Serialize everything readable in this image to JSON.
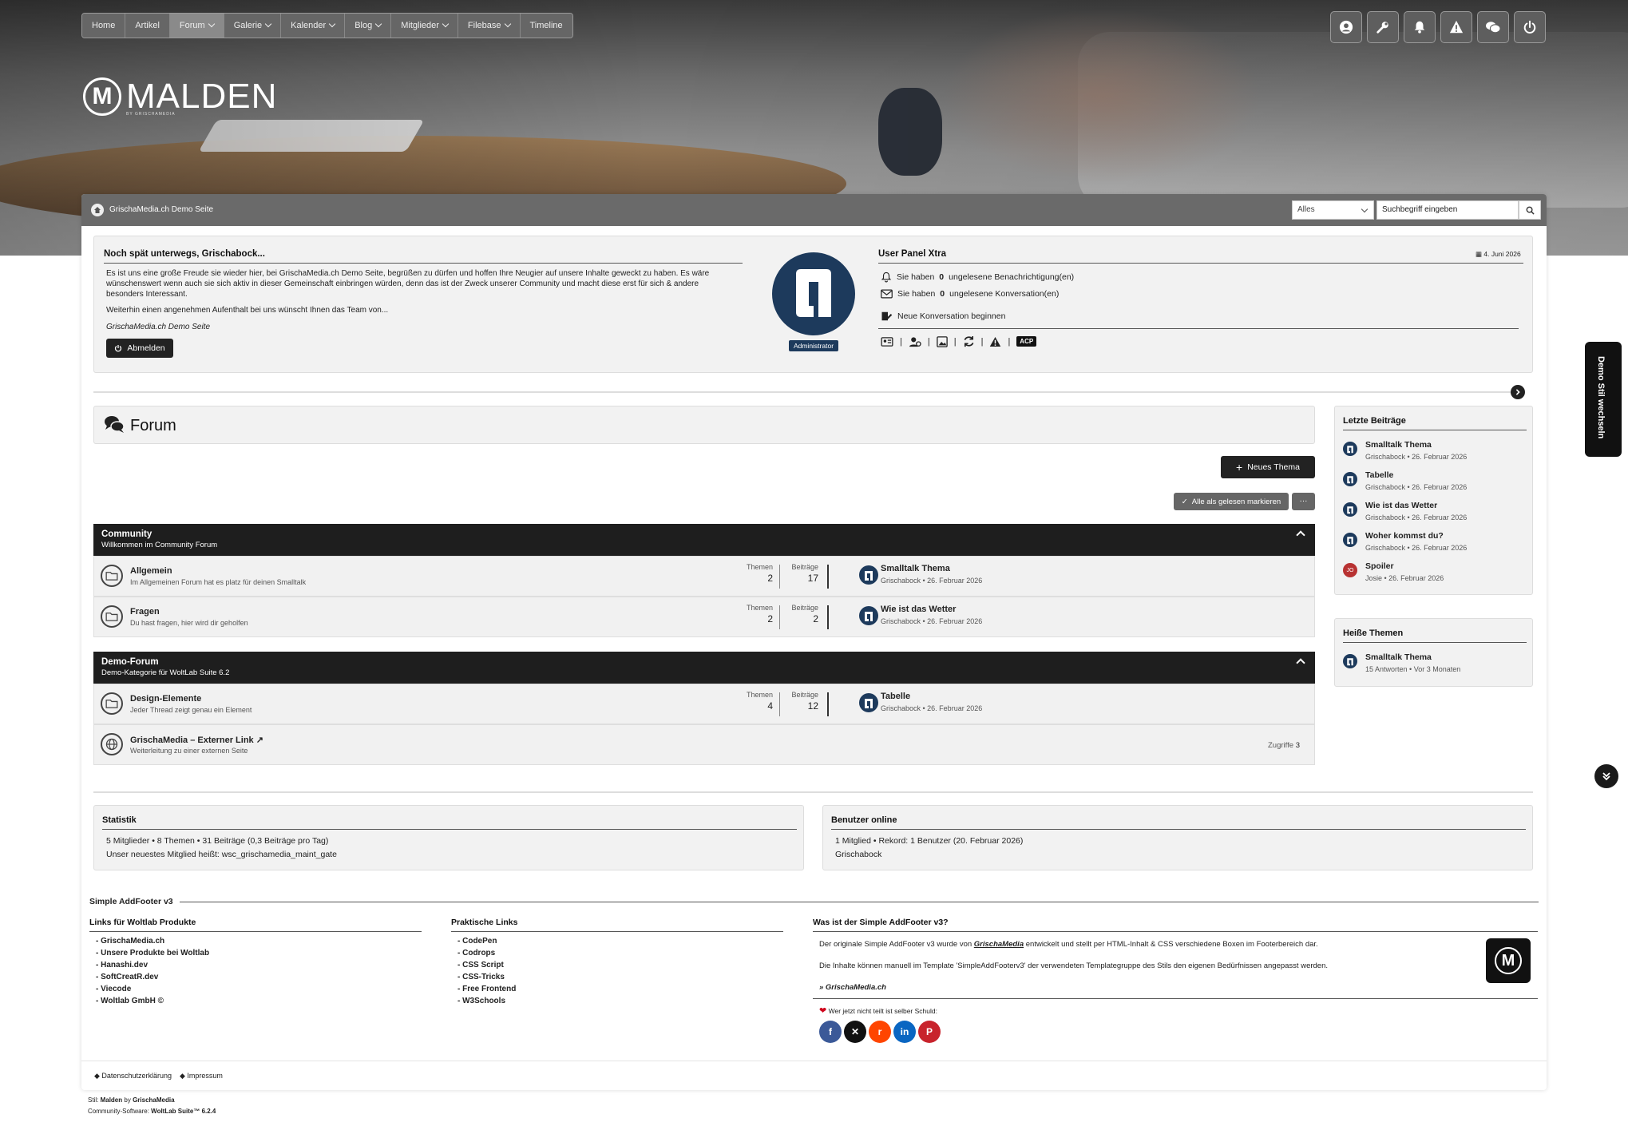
{
  "nav": {
    "items": [
      {
        "label": "Home",
        "dropdown": false
      },
      {
        "label": "Artikel",
        "dropdown": false
      },
      {
        "label": "Forum",
        "dropdown": true
      },
      {
        "label": "Galerie",
        "dropdown": true
      },
      {
        "label": "Kalender",
        "dropdown": true
      },
      {
        "label": "Blog",
        "dropdown": true
      },
      {
        "label": "Mitglieder",
        "dropdown": true
      },
      {
        "label": "Filebase",
        "dropdown": true
      },
      {
        "label": "Timeline",
        "dropdown": false
      }
    ],
    "active": "Forum",
    "user_icons": [
      "user-icon",
      "wrench-icon",
      "bell-icon",
      "warning-icon",
      "conversations-icon",
      "power-icon"
    ]
  },
  "logo": {
    "letter": "M",
    "word": "MALDEN",
    "sub": "BY GRISCHAMEDIA"
  },
  "breadcrumb": {
    "label": "GrischaMedia.ch Demo Seite"
  },
  "search": {
    "scope": "Alles",
    "value": "Suchbegriff eingeben"
  },
  "welcome": {
    "title": "Noch spät unterwegs, Grischabock...",
    "p1": "Es ist uns eine große Freude sie wieder hier, bei GrischaMedia.ch Demo Seite, begrüßen zu dürfen und hoffen Ihre Neugier auf unsere Inhalte geweckt zu haben. Es wäre wünschenswert wenn auch sie sich aktiv in dieser Gemeinschaft einbringen würden, denn das ist der Zweck unserer Community und macht diese erst für sich & andere besonders Interessant.",
    "p2": "Weiterhin einen angenehmen Aufenthalt bei uns wünscht Ihnen das Team von...",
    "sig": "GrischaMedia.ch Demo Seite",
    "logout": "Abmelden",
    "badge": "Administrator"
  },
  "userpanel": {
    "title": "User Panel Xtra",
    "date": "4. Juni 2026",
    "notif_pre": "Sie haben",
    "notif_count": "0",
    "notif_post": "ungelesene Benachrichtigung(en)",
    "conv_pre": "Sie haben",
    "conv_count": "0",
    "conv_post": "ungelesene Konversation(en)",
    "new_conv": "Neue Konversation beginnen",
    "acp": "ACP"
  },
  "forum": {
    "title": "Forum",
    "new_thread": "Neues Thema",
    "mark_read": "Alle als gelesen markieren",
    "more": "···",
    "themen_label": "Themen",
    "beitraege_label": "Beiträge",
    "categories": [
      {
        "name": "Community",
        "desc": "Willkommen im Community Forum",
        "boards": [
          {
            "name": "Allgemein",
            "desc": "Im Allgemeinen Forum hat es platz für deinen Smalltalk",
            "themen": "2",
            "beitraege": "17",
            "last_title": "Smalltalk Thema",
            "last_meta": "Grischabock • 26. Februar 2026"
          },
          {
            "name": "Fragen",
            "desc": "Du hast fragen, hier wird dir geholfen",
            "themen": "2",
            "beitraege": "2",
            "last_title": "Wie ist das Wetter",
            "last_meta": "Grischabock • 26. Februar 2026"
          }
        ]
      },
      {
        "name": "Demo-Forum",
        "desc": "Demo-Kategorie für WoltLab Suite 6.2",
        "boards": [
          {
            "name": "Design-Elemente",
            "desc": "Jeder Thread zeigt genau ein Element",
            "themen": "4",
            "beitraege": "12",
            "last_title": "Tabelle",
            "last_meta": "Grischabock • 26. Februar 2026"
          }
        ],
        "link": {
          "name": "GrischaMedia – Externer Link ↗",
          "desc": "Weiterleitung zu einer externen Seite",
          "hits_label": "Zugriffe",
          "hits": "3"
        }
      }
    ]
  },
  "sidebar": {
    "latest_title": "Letzte Beiträge",
    "latest": [
      {
        "title": "Smalltalk Thema",
        "meta": "Grischabock • 26. Februar 2026"
      },
      {
        "title": "Tabelle",
        "meta": "Grischabock • 26. Februar 2026"
      },
      {
        "title": "Wie ist das Wetter",
        "meta": "Grischabock • 26. Februar 2026"
      },
      {
        "title": "Woher kommst du?",
        "meta": "Grischabock • 26. Februar 2026"
      },
      {
        "title": "Spoiler",
        "meta": "Josie • 26. Februar 2026",
        "avatar_text": "JO"
      }
    ],
    "hot_title": "Heiße Themen",
    "hot": [
      {
        "title": "Smalltalk Thema",
        "meta": "15 Antworten • Vor 3 Monaten"
      }
    ]
  },
  "stats": {
    "title": "Statistik",
    "line1": "5 Mitglieder • 8 Themen • 31 Beiträge (0,3 Beiträge pro Tag)",
    "line2_pre": "Unser neuestes Mitglied heißt:",
    "line2_name": "wsc_grischamedia_maint_gate"
  },
  "online": {
    "title": "Benutzer online",
    "line1": "1 Mitglied • Rekord: 1 Benutzer (20. Februar 2026)",
    "line2": "Grischabock"
  },
  "footer": {
    "section": "Simple AddFooter v3",
    "col1_title": "Links für Woltlab Produkte",
    "col1": [
      "GrischaMedia.ch",
      "Unsere Produkte bei Woltlab",
      "Hanashi.dev",
      "SoftCreatR.dev",
      "Viecode",
      "Woltlab GmbH ©"
    ],
    "col2_title": "Praktische Links",
    "col2": [
      "CodePen",
      "Codrops",
      "CSS Script",
      "CSS-Tricks",
      "Free Frontend",
      "W3Schools"
    ],
    "col3_title": "Was ist der Simple AddFooter v3?",
    "col3_p1_pre": "Der originale Simple AddFooter v3 wurde von",
    "col3_p1_brand": "GrischaMedia",
    "col3_p1_post": "entwickelt und stellt per HTML-Inhalt & CSS verschiedene Boxen im Footerbereich dar.",
    "col3_p2": "Die Inhalte können manuell im Template 'SimpleAddFooterv3' der verwendeten Templategruppe des Stils den eigenen Bedürfnissen angepasst werden.",
    "col3_link": "» GrischaMedia.ch",
    "share": "Wer jetzt nicht teilt ist selber Schuld:",
    "social": [
      {
        "name": "facebook",
        "glyph": "f",
        "color": "#3b5998"
      },
      {
        "name": "x",
        "glyph": "✕",
        "color": "#111111"
      },
      {
        "name": "reddit",
        "glyph": "r",
        "color": "#ff4500"
      },
      {
        "name": "linkedin",
        "glyph": "in",
        "color": "#0a66c2"
      },
      {
        "name": "pinterest",
        "glyph": "P",
        "color": "#c8232c"
      }
    ]
  },
  "legal": {
    "privacy": "Datenschutzerklärung",
    "imprint": "Impressum"
  },
  "credits": {
    "style_pre": "Stil:",
    "style_name": "Malden",
    "style_by": "by",
    "style_author": "GrischaMedia",
    "software_pre": "Community-Software:",
    "software": "WoltLab Suite™ 6.2.4"
  },
  "demostyle": "Demo Stil wechseln",
  "colors": {
    "dark": "#1e1e1e",
    "panel": "#f2f2f2",
    "avatar_blue": "#1d3a5c",
    "heart": "#d0021b"
  }
}
